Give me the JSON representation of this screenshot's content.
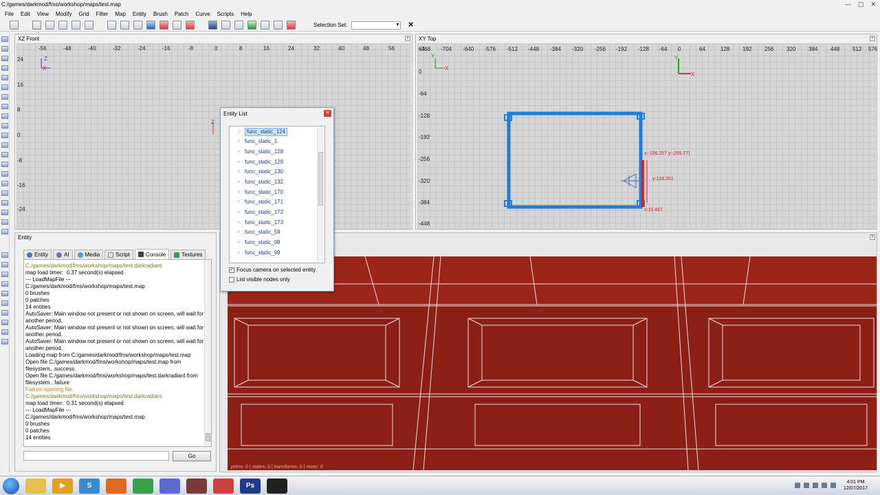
{
  "window": {
    "title": "C:/games/darkmod/fms/workshop/maps/test.map",
    "minimize": "—",
    "maximize": "▢",
    "close": "✕"
  },
  "menu": [
    "File",
    "Edit",
    "View",
    "Modify",
    "Grid",
    "Filter",
    "Map",
    "Entity",
    "Brush",
    "Patch",
    "Curve",
    "Scripts",
    "Help"
  ],
  "toolbar": {
    "selection_set_label": "Selection Set:",
    "selection_set_value": "",
    "clear_label": "✕"
  },
  "xz_view": {
    "title": "XZ Front",
    "top_ticks": [
      "-56",
      "-48",
      "-40",
      "-32",
      "-24",
      "-16",
      "-8",
      "0",
      "8",
      "16",
      "24",
      "32",
      "40",
      "48",
      "56"
    ],
    "left_ticks": [
      "24",
      "16",
      "8",
      "0",
      "-8",
      "-16",
      "-24"
    ],
    "axis_z": "Z",
    "axis_x": "X"
  },
  "xy_view": {
    "title": "XY Top",
    "top_ticks": [
      "-768",
      "-704",
      "-640",
      "-576",
      "-512",
      "-448",
      "-384",
      "-320",
      "-256",
      "-192",
      "-128",
      "-64",
      "0",
      "64",
      "128",
      "192",
      "256",
      "320",
      "384",
      "448",
      "512",
      "576"
    ],
    "left_ticks": [
      "64",
      "0",
      "-64",
      "-128",
      "-192",
      "-256",
      "-320",
      "-384",
      "-448"
    ],
    "axis_y": "Y",
    "axis_x": "X",
    "measure_xy": "x:-106.257  y:-255.77)",
    "measure_y": "y:128.261",
    "measure_x": "x:10.467"
  },
  "entity_list": {
    "title": "Entity List",
    "items": [
      "func_static_124",
      "func_static_1",
      "func_static_128",
      "func_static_129",
      "func_static_130",
      "func_static_132",
      "func_static_170",
      "func_static_171",
      "func_static_172",
      "func_static_173",
      "func_static_59",
      "func_static_98",
      "func_static_99"
    ],
    "selected_index": 0,
    "focus_camera": "Focus camera on selected entity",
    "visible_only": "List visible nodes only",
    "focus_checked": "✓"
  },
  "entity_panel": {
    "title": "Entity",
    "tabs": [
      "Entity",
      "AI",
      "Media",
      "Script",
      "Console",
      "Textures"
    ],
    "active_tab": "Console",
    "go_label": "Go"
  },
  "console_lines": [
    {
      "text": "C:/games/darkmod/fms/workshop/maps/test.darkradiant",
      "color": "olive"
    },
    {
      "text": "map load timer:  0.37 second(s) elapsed",
      "color": "black"
    },
    {
      "text": "--- LoadMapFile ---",
      "color": "black"
    },
    {
      "text": "C:/games/darkmod/fms/workshop/maps/test.map",
      "color": "black"
    },
    {
      "text": "0 brushes",
      "color": "black"
    },
    {
      "text": "0 patches",
      "color": "black"
    },
    {
      "text": "14 entities",
      "color": "black"
    },
    {
      "text": "AutoSaver: Main window not present or not shown on screen, will wait for another period.",
      "color": "black"
    },
    {
      "text": "AutoSaver: Main window not present or not shown on screen, will wait for another period.",
      "color": "black"
    },
    {
      "text": "AutoSaver: Main window not present or not shown on screen, will wait for another period.",
      "color": "black"
    },
    {
      "text": "Loading map from C:/games/darkmod/fms/workshop/maps/test.map",
      "color": "black"
    },
    {
      "text": "Open file C:/games/darkmod/fms/workshop/maps/test.map from filesystem...success.",
      "color": "black"
    },
    {
      "text": "Open file C:/games/darkmod/fms/workshop/maps/test.darkradiant from filesystem...failure",
      "color": "black"
    },
    {
      "text": "Failure opening file:",
      "color": "orange"
    },
    {
      "text": "C:/games/darkmod/fms/workshop/maps/test.darkradiant",
      "color": "olive"
    },
    {
      "text": "map load timer:  0.31 second(s) elapsed",
      "color": "black"
    },
    {
      "text": "--- LoadMapFile ---",
      "color": "black"
    },
    {
      "text": "C:/games/darkmod/fms/workshop/maps/test.map",
      "color": "black"
    },
    {
      "text": "0 brushes",
      "color": "black"
    },
    {
      "text": "0 patches",
      "color": "black"
    },
    {
      "text": "14 entities",
      "color": "black"
    }
  ],
  "camera": {
    "status": "prims: 0 | states: 0 | transforms: 0 | msec: 0"
  },
  "taskbar": {
    "apps": [
      "explorer-icon",
      "media-player-icon",
      "skype-icon",
      "firefox-icon",
      "calculator-icon",
      "discord-icon",
      "darkradiant-icon",
      "audio-icon",
      "photoshop-icon",
      "steam-icon"
    ],
    "time": "4:01 PM",
    "date": "12/07/2017"
  },
  "colors": {
    "brush_blue": "#1e7fd8",
    "brush_red": "#e02020",
    "camera_red": "#8c1f16",
    "accent": "#2a62c9"
  }
}
